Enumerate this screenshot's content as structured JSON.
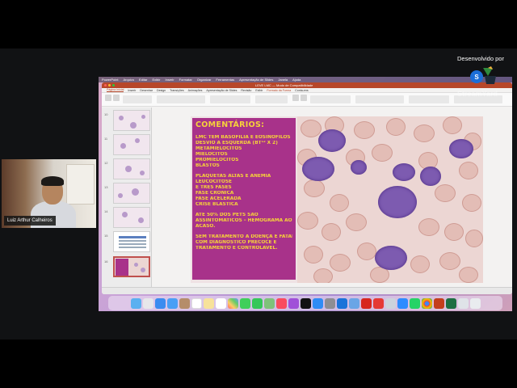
{
  "branding": {
    "developed_by": "Desenvolvido por",
    "watermark": "StreamYard"
  },
  "webcam": {
    "participant_name": "Luiz Arthur Calheiros"
  },
  "mac_menubar": [
    "PowerPoint",
    "Arquivo",
    "Editar",
    "Exibir",
    "Inserir",
    "Formatar",
    "Organizar",
    "Ferramentas",
    "Apresentação de Slides",
    "Janela",
    "Ajuda"
  ],
  "ppt": {
    "window_title": "LEVE LMC — Modo de Compatibilidade",
    "ribbon_tabs": [
      "Página Inicial",
      "Inserir",
      "Desenhar",
      "Design",
      "Transições",
      "Animações",
      "Apresentação de Slides",
      "Revisão",
      "Exibir",
      "Formato da Forma",
      "Conta-ens"
    ],
    "active_tab_index": 0,
    "slide_numbers": [
      "10",
      "11",
      "12",
      "13",
      "14",
      "15",
      "16"
    ],
    "selected_slide_index": 6
  },
  "slide": {
    "title": "COMENTÁRIOS:",
    "block1": [
      "LMC TEM BASOFILIA E EOSINÓFILOS",
      "DESVIO À ESQUERDA (BT¹² X 2)",
      "METAMIELÓCITOS",
      "MIELÓCITOS",
      "PROMIELÓCITOS",
      "BLASTOS"
    ],
    "block2": [
      "PLAQUETAS ALTAS E ANEMIA",
      "LEUCOCITOSE",
      "É TRÊS FASES",
      "FASE CRÔNICA",
      "FASE ACELERADA",
      "CRISE BLÁSTICA"
    ],
    "block3": [
      "ATÉ 50% DOS PETS SÃO",
      "ASSINTOMÁTICOS – HEMOGRAMA AO",
      "ACASO."
    ],
    "block4": [
      "SEM TRATAMENTO À DOENÇA É FATAL",
      "COM DIAGNÓSTICO PRECOCE E",
      "TRATAMENTO É CONTROLÁVEL."
    ]
  },
  "colors": {
    "comment_box": "#a8328a",
    "comment_text": "#f6d23a",
    "ppt_accent": "#b7472a"
  },
  "dock_icons": [
    "finder-icon",
    "launchpad-icon",
    "safari-icon",
    "mail-icon",
    "contacts-icon",
    "calendar-icon",
    "notes-icon",
    "reminders-icon",
    "photos-icon",
    "messages-icon",
    "facetime-icon",
    "maps-icon",
    "music-icon",
    "podcasts-icon",
    "appletv-icon",
    "appstore-icon",
    "settings-icon",
    "trello-icon",
    "preview-icon",
    "acrobat-icon",
    "pdf-icon",
    "other-icon",
    "zoom-icon",
    "whatsapp-icon",
    "chrome-icon",
    "powerpoint-icon",
    "excel-icon",
    "finder-window-icon",
    "trash-icon"
  ]
}
